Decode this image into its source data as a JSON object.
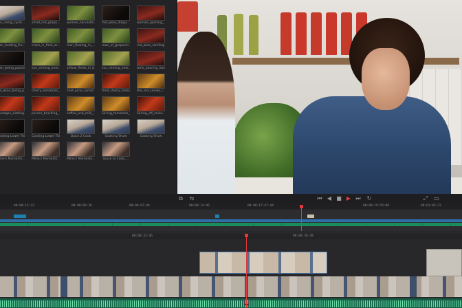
{
  "media_pool": {
    "clips": [
      {
        "name": "sun_rising_cycle...",
        "thumb": "t-kitchen"
      },
      {
        "name": "smell_red_grape...",
        "thumb": "t-red"
      },
      {
        "name": "women_harvestin...",
        "thumb": "t-green"
      },
      {
        "name": "fed_wine_drippi...",
        "thumb": "t-dark"
      },
      {
        "name": "woman_opening_...",
        "thumb": "t-red"
      },
      {
        "name": "man_holding_fru...",
        "thumb": "t-green"
      },
      {
        "name": "crops_in_field_st...",
        "thumb": "t-green"
      },
      {
        "name": "man_flowing_in_...",
        "thumb": "t-green"
      },
      {
        "name": "rows_of_grapevin...",
        "thumb": "t-green"
      },
      {
        "name": "red_wine_swirling...",
        "thumb": "t-red"
      },
      {
        "name": "man_being_pourin...",
        "thumb": "t-dark"
      },
      {
        "name": "sun_shining_over...",
        "thumb": "t-olive"
      },
      {
        "name": "yellow_fields_in_b...",
        "thumb": "t-olive"
      },
      {
        "name": "sun_shining_over...",
        "thumb": "t-olive"
      },
      {
        "name": "wine_pouring_into...",
        "thumb": "t-red"
      },
      {
        "name": "red_wine_being_p...",
        "thumb": "t-red"
      },
      {
        "name": "cherry_tomatoes_...",
        "thumb": "t-fire"
      },
      {
        "name": "chef_picks_tomat...",
        "thumb": "t-gold"
      },
      {
        "name": "fried_cherry_toma...",
        "thumb": "t-fire"
      },
      {
        "name": "the_red_smoke_l...",
        "thumb": "t-gold"
      },
      {
        "name": "sausages_sizzling...",
        "thumb": "t-fire"
      },
      {
        "name": "person_brushing_...",
        "thumb": "t-fire"
      },
      {
        "name": "coffee_and_milk_...",
        "thumb": "t-gold"
      },
      {
        "name": "Slicing_tomatoes_...",
        "thumb": "t-gold"
      },
      {
        "name": "Slicing_off_onion...",
        "thumb": "t-fire"
      },
      {
        "name": "Cooking Lower Thi...",
        "thumb": "t-dark"
      },
      {
        "name": "Cooking Lower Thi...",
        "thumb": "t-dark"
      },
      {
        "name": "Quick 2 Cook",
        "thumb": "t-kitchen"
      },
      {
        "name": "Cooking Show",
        "thumb": "t-kitchen"
      },
      {
        "name": "Cooking Show",
        "thumb": "t-kitchen"
      },
      {
        "name": "Millie's Moments ...",
        "thumb": "t-faces"
      },
      {
        "name": "Millie's Moments ...",
        "thumb": "t-faces"
      },
      {
        "name": "Millie's Moments ...",
        "thumb": "t-faces"
      },
      {
        "name": "Quick to Cook_...",
        "thumb": "t-faces"
      }
    ]
  },
  "timeline": {
    "mini_ruler_labels": [
      "00:00:15:32",
      "00:00:06:36",
      "00:00:07:44",
      "00:00:14:46",
      "00:00:17:47:44",
      "00:00:19:59:00",
      "00:01:03:33"
    ],
    "main_ruler_labels": [
      "00:00:33:46",
      "00:00:36:48"
    ]
  },
  "icons": {
    "transport": [
      "skip-back-icon",
      "step-back-icon",
      "stop-icon",
      "play-icon",
      "step-forward-icon",
      "loop-icon"
    ]
  }
}
